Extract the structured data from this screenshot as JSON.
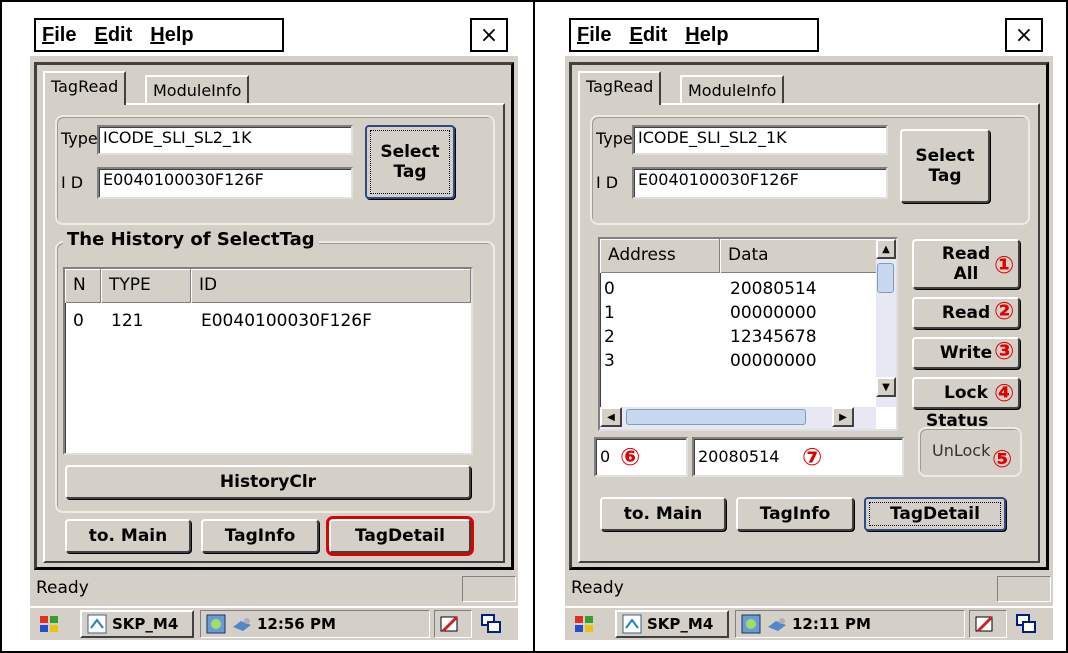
{
  "menu": {
    "file": "ile",
    "file_hot": "F",
    "edit": "dit",
    "edit_hot": "E",
    "help": "elp",
    "help_hot": "H"
  },
  "close_glyph": "×",
  "tabs": {
    "tagread": "TagRead",
    "moduleinfo": "ModuleInfo"
  },
  "left": {
    "type_label": "Type",
    "type_value": "ICODE_SLI_SL2_1K",
    "id_label": "I D",
    "id_value": "E0040100030F126F",
    "select_tag": "Select\nTag",
    "history_title": "The History of SelectTag",
    "columns": [
      "N",
      "TYPE",
      "ID"
    ],
    "rows": [
      {
        "n": "0",
        "type": "121",
        "id": "E0040100030F126F"
      }
    ],
    "history_clear": "HistoryClr",
    "to_main": "to. Main",
    "tag_info": "TagInfo",
    "tag_detail": "TagDetail",
    "status": "Ready",
    "taskbar_app": "SKP_M4",
    "time": "12:56 PM"
  },
  "right": {
    "type_label": "Type",
    "type_value": "ICODE_SLI_SL2_1K",
    "id_label": "I D",
    "id_value": "E0040100030F126F",
    "select_tag": "Select\nTag",
    "columns": [
      "Address",
      "Data"
    ],
    "rows": [
      {
        "address": "0",
        "data": "20080514"
      },
      {
        "address": "1",
        "data": "00000000"
      },
      {
        "address": "2",
        "data": "12345678"
      },
      {
        "address": "3",
        "data": "00000000"
      }
    ],
    "read_all": "Read\nAll",
    "read": "Read",
    "write": "Write",
    "lock": "Lock",
    "status_label": "Status",
    "status_value": "UnLock",
    "address_input": "0",
    "data_input": "20080514",
    "to_main": "to. Main",
    "tag_info": "TagInfo",
    "tag_detail": "TagDetail",
    "status": "Ready",
    "taskbar_app": "SKP_M4",
    "time": "12:11 PM",
    "markers": [
      "①",
      "②",
      "③",
      "④",
      "⑤",
      "⑥",
      "⑦"
    ]
  },
  "colors": {
    "window_bg": "#d4d0c8",
    "highlight_red": "#e00000"
  }
}
